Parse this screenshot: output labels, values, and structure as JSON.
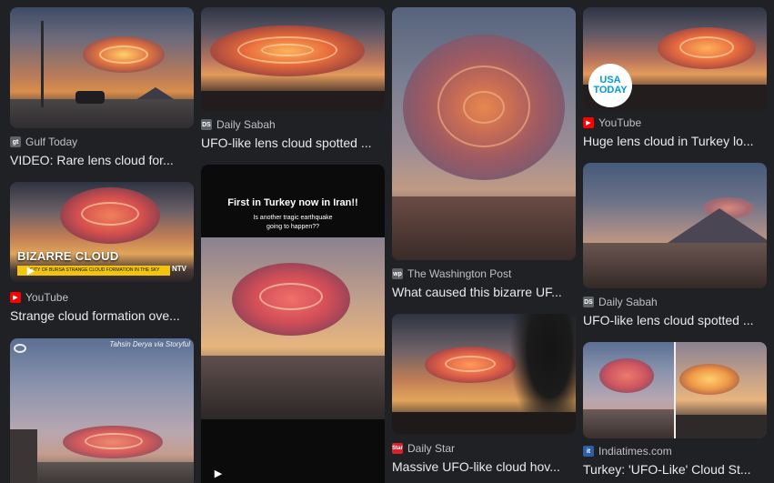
{
  "results": [
    {
      "source": "Gulf Today",
      "title": "VIDEO: Rare lens cloud for...",
      "favicon_icon": "gulf-today-icon",
      "favicon_color": "#5f6368",
      "favicon_text": "gt"
    },
    {
      "source": "YouTube",
      "title": "Strange cloud formation ove...",
      "favicon_icon": "youtube-icon",
      "favicon_color": "#ff0000",
      "favicon_text": "▶",
      "overlay_caption": "BIZARRE CLOUD FORMATION",
      "overlay_ticker": "CITY OF BURSA STRANGE CLOUD FORMATION IN THE SKY",
      "overlay_channel": "NTV"
    },
    {
      "credit": "Tahsin Derya via Storyful"
    },
    {
      "source": "Daily Sabah",
      "title": "UFO-like lens cloud spotted ...",
      "favicon_icon": "daily-sabah-icon",
      "favicon_color": "#5f6368",
      "favicon_text": "DS"
    },
    {
      "overlay_line1": "First in Turkey now in Iran!!",
      "overlay_line2": "Is another tragic earthquake",
      "overlay_line3": "going to happen??"
    },
    {
      "source": "The Washington Post",
      "title": "What caused this bizarre UF...",
      "favicon_icon": "washington-post-icon",
      "favicon_color": "#5f6368",
      "favicon_text": "wp"
    },
    {
      "source": "Daily Star",
      "title": "Massive UFO-like cloud hov...",
      "favicon_icon": "daily-star-icon",
      "favicon_color": "#d4232b",
      "favicon_text": "Star"
    },
    {
      "source": "YouTube",
      "title": "Huge lens cloud in Turkey lo...",
      "favicon_icon": "youtube-icon",
      "favicon_color": "#ff0000",
      "favicon_text": "▶",
      "badge_line1": "USA",
      "badge_line2": "TODAY"
    },
    {
      "source": "Daily Sabah",
      "title": "UFO-like lens cloud spotted ...",
      "favicon_icon": "daily-sabah-icon",
      "favicon_color": "#5f6368",
      "favicon_text": "DS"
    },
    {
      "source": "Indiatimes.com",
      "title": "Turkey: 'UFO-Like' Cloud St...",
      "favicon_icon": "indiatimes-icon",
      "favicon_color": "#2b5fa8",
      "favicon_text": "it"
    }
  ]
}
